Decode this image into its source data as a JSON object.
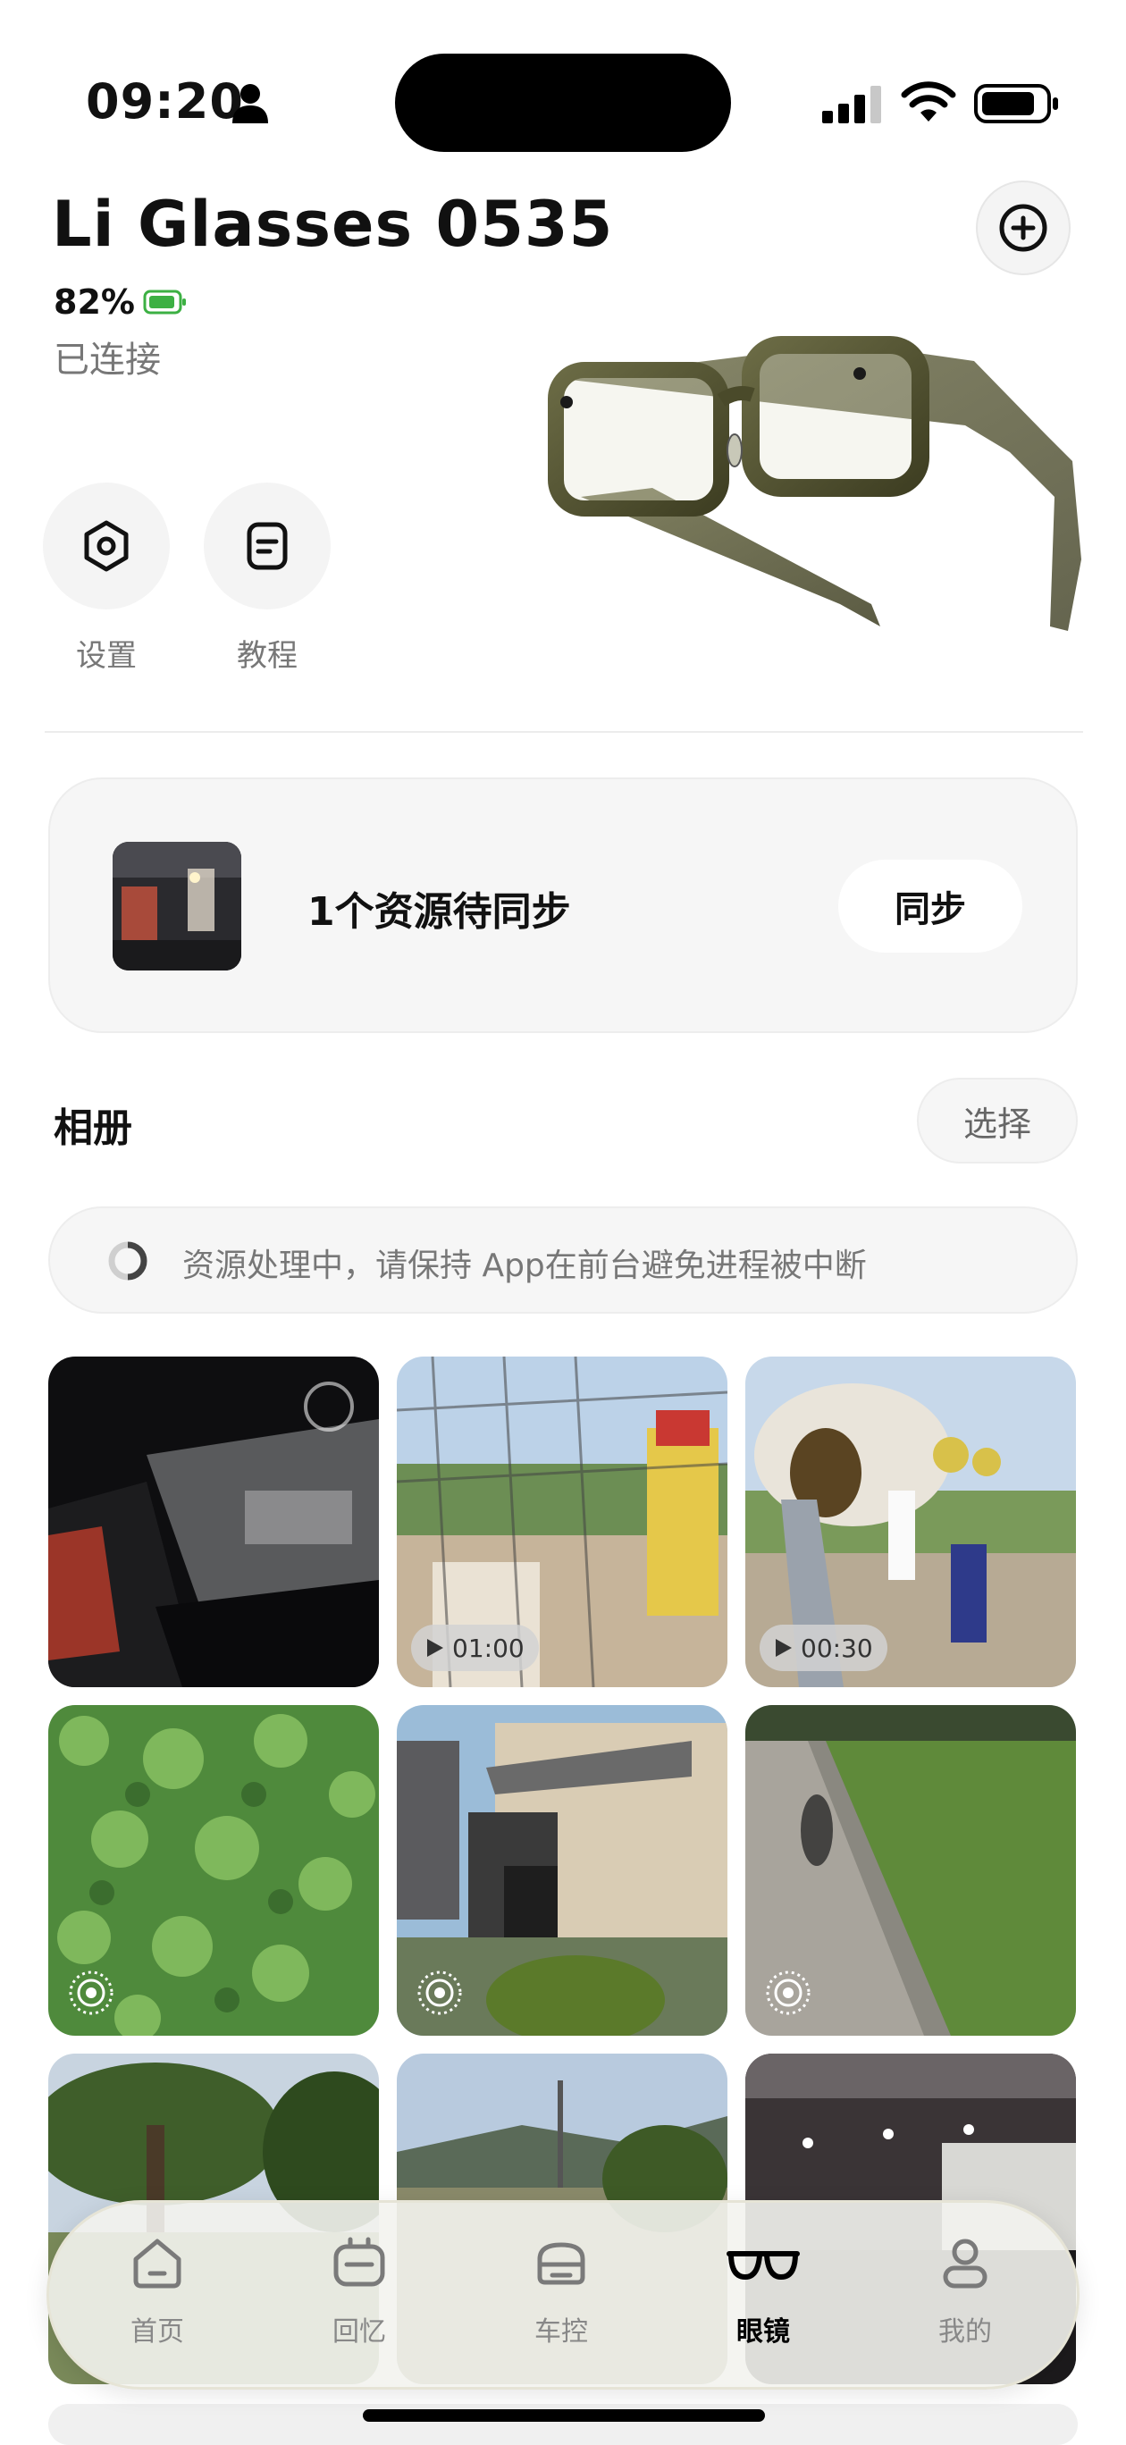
{
  "status_bar": {
    "time": "09:20"
  },
  "header": {
    "device_name": "Li Glasses 0535",
    "battery": "82%",
    "connection_status": "已连接"
  },
  "quick_actions": [
    {
      "label": "设置",
      "icon": "hexagon-settings-icon"
    },
    {
      "label": "教程",
      "icon": "document-icon"
    }
  ],
  "sync": {
    "text": "1个资源待同步",
    "button": "同步"
  },
  "album": {
    "title": "相册",
    "select_label": "选择",
    "processing_notice": "资源处理中，请保持 App在前台避免进程被中断",
    "items": [
      {
        "kind": "photo",
        "scene": "parking garage"
      },
      {
        "kind": "video",
        "duration": "01:00",
        "scene": "playground net"
      },
      {
        "kind": "video",
        "duration": "00:30",
        "scene": "playground slide"
      },
      {
        "kind": "live",
        "scene": "clover"
      },
      {
        "kind": "live",
        "scene": "house"
      },
      {
        "kind": "live",
        "scene": "park path"
      },
      {
        "kind": "photo",
        "scene": "trees"
      },
      {
        "kind": "photo",
        "scene": "street"
      },
      {
        "kind": "photo",
        "scene": "garage ceiling"
      }
    ]
  },
  "tabs": [
    {
      "label": "首页",
      "active": false
    },
    {
      "label": "回忆",
      "active": false
    },
    {
      "label": "车控",
      "active": false
    },
    {
      "label": "眼镜",
      "active": true
    },
    {
      "label": "我的",
      "active": false
    }
  ],
  "colors": {
    "battery_green": "#3cb043",
    "glasses_frame": "#4a4a2a"
  }
}
